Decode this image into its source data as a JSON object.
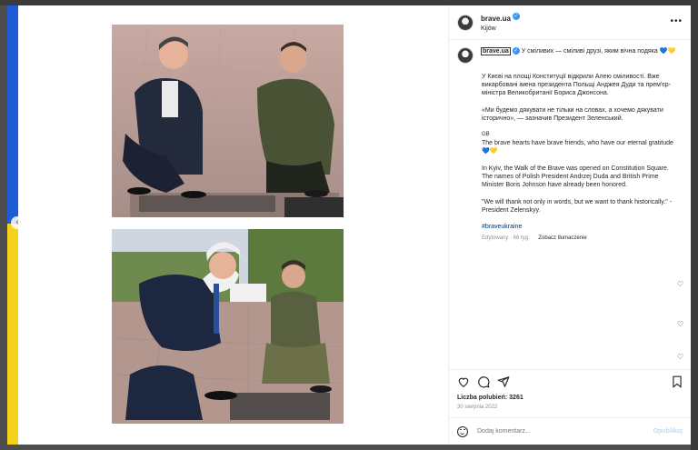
{
  "post": {
    "username": "brave.ua",
    "location": "Kijów",
    "more_icon": "more-horizontal-icon",
    "caption": {
      "first_line": "У сміливих — сміливі друзі, яким вічна подяка 💙💛",
      "para1": "У Києві на площі Конституції відкрили Алею сміливості. Вже викарбовані імена президента Польщі Анджея Дуди та прем'єр-міністра Великобританії Бориса Джонсона.",
      "para2": "«Ми будемо дякувати не тільки на словах, а хочемо дякувати історично», — зазначив Президент Зеленський.",
      "lang_tag": "GB",
      "para3": "The brave hearts have brave friends, who have our eternal gratitude 💙💛",
      "para4": "In Kyiv, the Walk of the Brave was opened on Constitution Square. The names of Polish President Andrzej Duda and British Prime Minister Boris Johnson have already been honored.",
      "para5": "\"We will thank not only in words, but we want to thank historically.\" - President Zelenskyy.",
      "hashtag": "#braveukraine"
    },
    "meta": {
      "edited": "Edytowany · 66 tyg.",
      "translate": "Zobacz tłumaczenie"
    },
    "likes": "Liczba polubień: 3261",
    "date": "30 sierpnia 2022",
    "comment_placeholder": "Dodaj komentarz...",
    "post_button": "Opublikuj"
  },
  "colors": {
    "flag_blue": "#1f5bd6",
    "flag_yellow": "#f2d21b",
    "verified": "#3897f0",
    "link": "#00376b"
  }
}
